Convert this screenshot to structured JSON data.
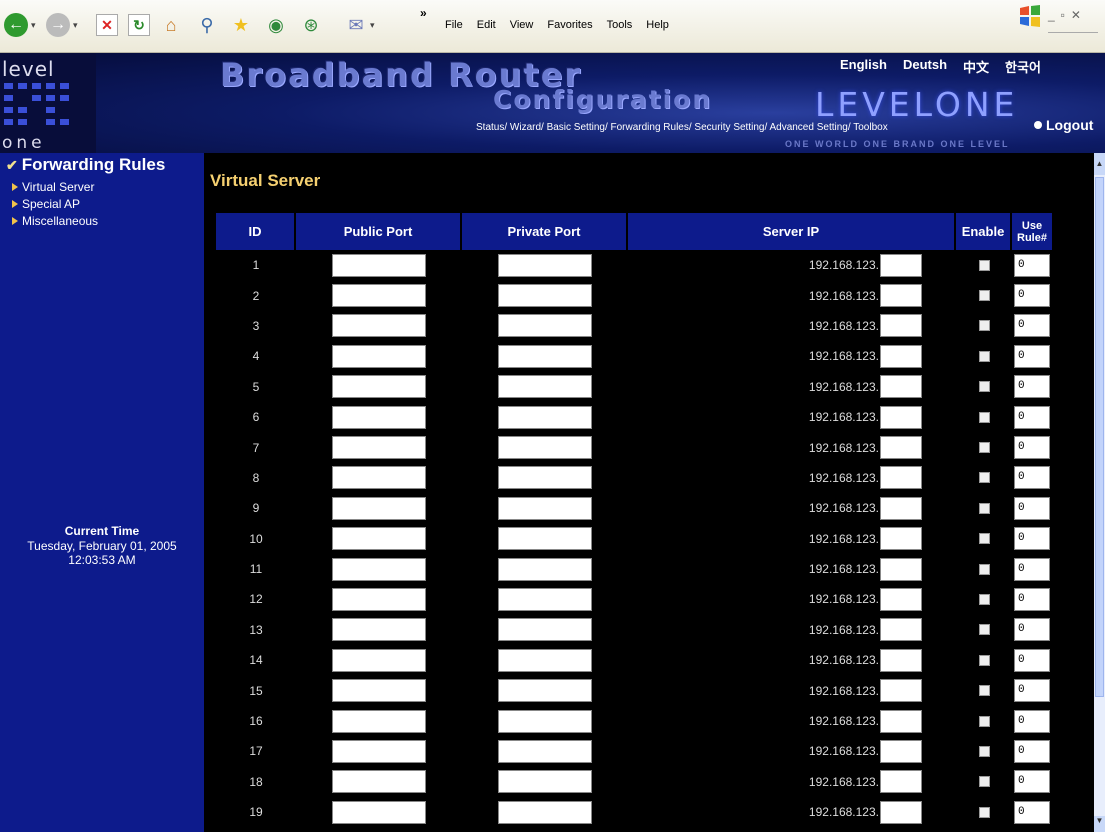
{
  "browser": {
    "menu": [
      "File",
      "Edit",
      "View",
      "Favorites",
      "Tools",
      "Help"
    ],
    "overflow_chevron": "»"
  },
  "header": {
    "logo_top": "level",
    "logo_bottom": "one",
    "title_line1": "Broadband Router",
    "title_line2": "Configuration",
    "languages": [
      "English",
      "Deutsh",
      "中文",
      "한국어"
    ],
    "brand": "LEVELONE",
    "nav": "Status/ Wizard/ Basic Setting/ Forwarding Rules/ Security Setting/ Advanced Setting/ Toolbox",
    "logout": "Logout",
    "tagline": "ONE WORLD  ONE BRAND  ONE LEVEL"
  },
  "sidebar": {
    "section_title": "Forwarding Rules",
    "items": [
      "Virtual Server",
      "Special AP",
      "Miscellaneous"
    ],
    "time_label": "Current Time",
    "time_date": "Tuesday, February 01, 2005",
    "time_clock": "12:03:53 AM"
  },
  "main": {
    "page_title": "Virtual Server",
    "columns": [
      "ID",
      "Public Port",
      "Private Port",
      "Server IP",
      "Enable",
      "Use Rule#"
    ],
    "ip_prefix": "192.168.123.",
    "rule_default": "0",
    "rows": [
      "1",
      "2",
      "3",
      "4",
      "5",
      "6",
      "7",
      "8",
      "9",
      "10",
      "11",
      "12",
      "13",
      "14",
      "15",
      "16",
      "17",
      "18",
      "19"
    ]
  },
  "colors": {
    "sidebar_bg": "#0d1b8c",
    "header_cell_bg": "#0d1b8c",
    "title_yellow": "#f5d070",
    "main_bg": "#000000"
  }
}
